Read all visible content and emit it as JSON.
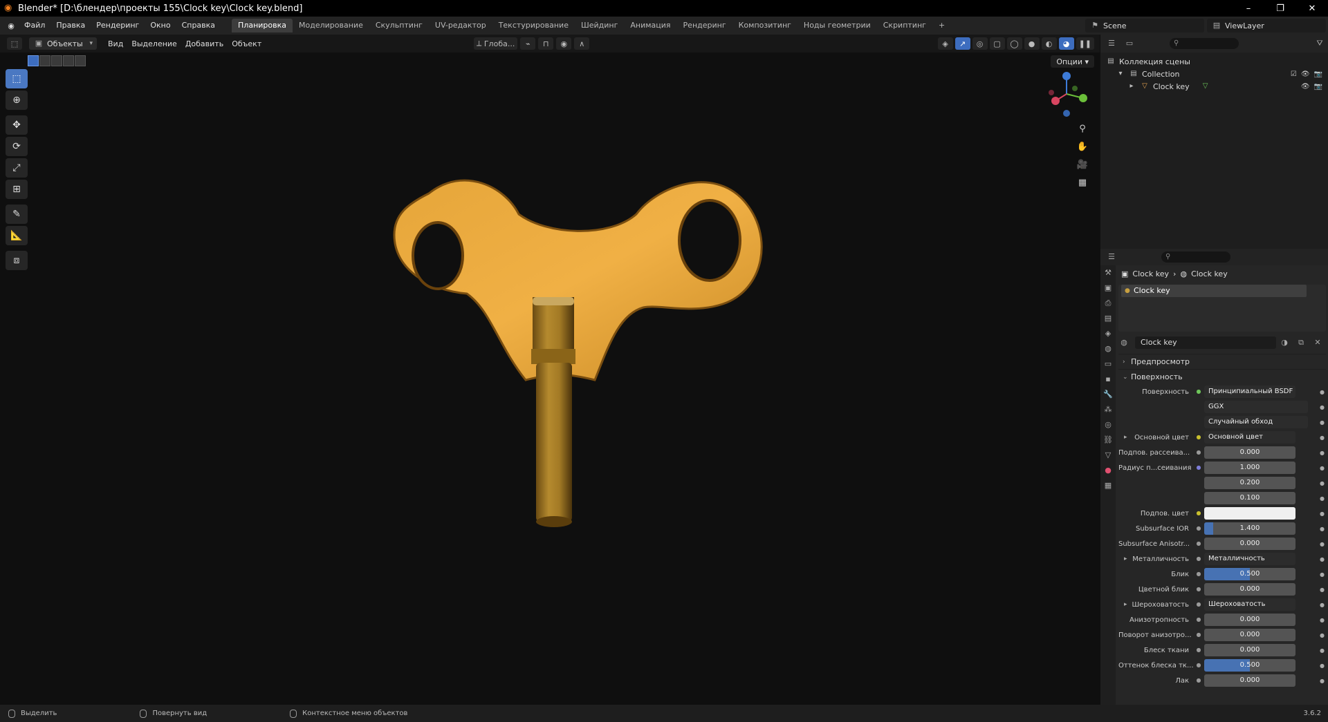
{
  "window": {
    "title": "Blender* [D:\\блендер\\проекты 155\\Clock key\\Clock key.blend]",
    "controls": [
      "–",
      "❐",
      "✕"
    ]
  },
  "menu": [
    "Файл",
    "Правка",
    "Рендеринг",
    "Окно",
    "Справка"
  ],
  "workspaces": {
    "items": [
      "Планировка",
      "Моделирование",
      "Скульптинг",
      "UV-редактор",
      "Текстурирование",
      "Шейдинг",
      "Анимация",
      "Рендеринг",
      "Композитинг",
      "Ноды геометрии",
      "Скриптинг"
    ],
    "active": "Планировка",
    "add": "+"
  },
  "scene": {
    "name": "Scene",
    "view_layer": "ViewLayer"
  },
  "viewport": {
    "mode": "Объекты",
    "menu": [
      "Вид",
      "Выделение",
      "Добавить",
      "Объект"
    ],
    "transform": "Глоба...",
    "options": "Опции"
  },
  "outliner": {
    "root": "Коллекция сцены",
    "collection": "Collection",
    "object": "Clock key"
  },
  "properties": {
    "breadcrumb": [
      "Clock key",
      "Clock key"
    ],
    "slot": "Clock key",
    "material": "Clock key",
    "sections": {
      "preview": "Предпросмотр",
      "surface": "Поверхность"
    },
    "rows": [
      {
        "label": "Поверхность",
        "kind": "link",
        "value": "Принципиальный BSDF",
        "dot": "green"
      },
      {
        "label": "",
        "kind": "drop",
        "value": "GGX"
      },
      {
        "label": "",
        "kind": "drop",
        "value": "Случайный обход"
      },
      {
        "label": "Основной цвет",
        "kind": "link",
        "value": "Основной цвет",
        "dot": "yellow",
        "expand": true
      },
      {
        "label": "Подпов. рассеива...",
        "kind": "num",
        "value": "0.000",
        "dot": "gray"
      },
      {
        "label": "Радиус п...сеивания",
        "kind": "num",
        "value": "1.000",
        "dot": "purple"
      },
      {
        "label": "",
        "kind": "num",
        "value": "0.200"
      },
      {
        "label": "",
        "kind": "num",
        "value": "0.100"
      },
      {
        "label": "Подпов. цвет",
        "kind": "color",
        "value": "",
        "dot": "yellow"
      },
      {
        "label": "Subsurface IOR",
        "kind": "num",
        "value": "1.400",
        "dot": "gray",
        "fill": 0.1
      },
      {
        "label": "Subsurface Anisotr...",
        "kind": "num",
        "value": "0.000",
        "dot": "gray"
      },
      {
        "label": "Металличность",
        "kind": "link",
        "value": "Металличность",
        "dot": "gray",
        "expand": true
      },
      {
        "label": "Блик",
        "kind": "num",
        "value": "0.500",
        "dot": "gray",
        "fill": 0.5
      },
      {
        "label": "Цветной блик",
        "kind": "num",
        "value": "0.000",
        "dot": "gray"
      },
      {
        "label": "Шероховатость",
        "kind": "link",
        "value": "Шероховатость",
        "dot": "gray",
        "expand": true
      },
      {
        "label": "Анизотропность",
        "kind": "num",
        "value": "0.000",
        "dot": "gray"
      },
      {
        "label": "Поворот анизотро...",
        "kind": "num",
        "value": "0.000",
        "dot": "gray"
      },
      {
        "label": "Блеск ткани",
        "kind": "num",
        "value": "0.000",
        "dot": "gray"
      },
      {
        "label": "Оттенок блеска тк...",
        "kind": "num",
        "value": "0.500",
        "dot": "gray",
        "fill": 0.5
      },
      {
        "label": "Лак",
        "kind": "num",
        "value": "0.000",
        "dot": "gray"
      }
    ]
  },
  "status": {
    "items": [
      "Выделить",
      "Повернуть вид",
      "Контекстное меню объектов"
    ],
    "version": "3.6.2"
  }
}
